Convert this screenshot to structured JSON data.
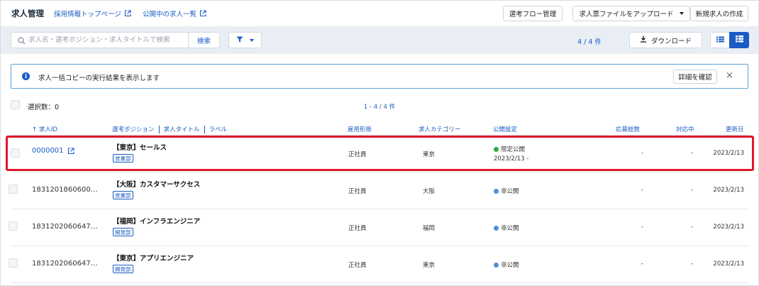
{
  "header": {
    "title": "求人管理",
    "links": [
      {
        "label": "採用情報トップページ"
      },
      {
        "label": "公開中の求人一覧"
      }
    ],
    "buttons": {
      "flow": "選考フロー管理",
      "upload": "求人票ファイルをアップロード",
      "create": "新規求人の作成"
    }
  },
  "search": {
    "placeholder": "求人名・選考ポジション・求人タイトルで検索",
    "button": "検索",
    "count": "4 / 4 件",
    "download": "ダウンロード"
  },
  "notice": {
    "text": "求人一括コピーの実行結果を表示します",
    "detail": "詳細を確認",
    "close": "×"
  },
  "selection": {
    "label": "選択数：0",
    "pager": "1 - 4 / 4 件"
  },
  "columns": {
    "id": "↑ 求人ID",
    "position": "選考ポジション",
    "title": "求人タイトル",
    "label": "ラベル",
    "employment": "雇用形態",
    "category": "求人カテゴリー",
    "publish": "公開設定",
    "applications": "応募総数",
    "handling": "対応中",
    "updated": "更新日"
  },
  "colors": {
    "accent": "#1a5bc4",
    "limited": "#2eaa44",
    "private": "#4a90d9",
    "highlight": "#e0162b"
  },
  "rows": [
    {
      "id": "0000001",
      "title": "【東京】セールス",
      "tag": "営業部",
      "employment": "正社員",
      "category": "東京",
      "status": "限定公開",
      "status_date": "2023/2/13 -",
      "applications": "-",
      "handling": "-",
      "updated": "2023/2/13"
    },
    {
      "id": "1831201860600…",
      "title": "【大阪】カスタマーサクセス",
      "tag": "営業部",
      "employment": "正社員",
      "category": "大阪",
      "status": "非公開",
      "status_date": "",
      "applications": "-",
      "handling": "-",
      "updated": "2023/2/13"
    },
    {
      "id": "1831202060647…",
      "title": "【福岡】インフラエンジニア",
      "tag": "開発部",
      "employment": "正社員",
      "category": "福岡",
      "status": "非公開",
      "status_date": "",
      "applications": "-",
      "handling": "-",
      "updated": "2023/2/13"
    },
    {
      "id": "1831202060647…",
      "title": "【東京】アプリエンジニア",
      "tag": "開発部",
      "employment": "正社員",
      "category": "東京",
      "status": "非公開",
      "status_date": "",
      "applications": "-",
      "handling": "-",
      "updated": "2023/2/13"
    }
  ]
}
